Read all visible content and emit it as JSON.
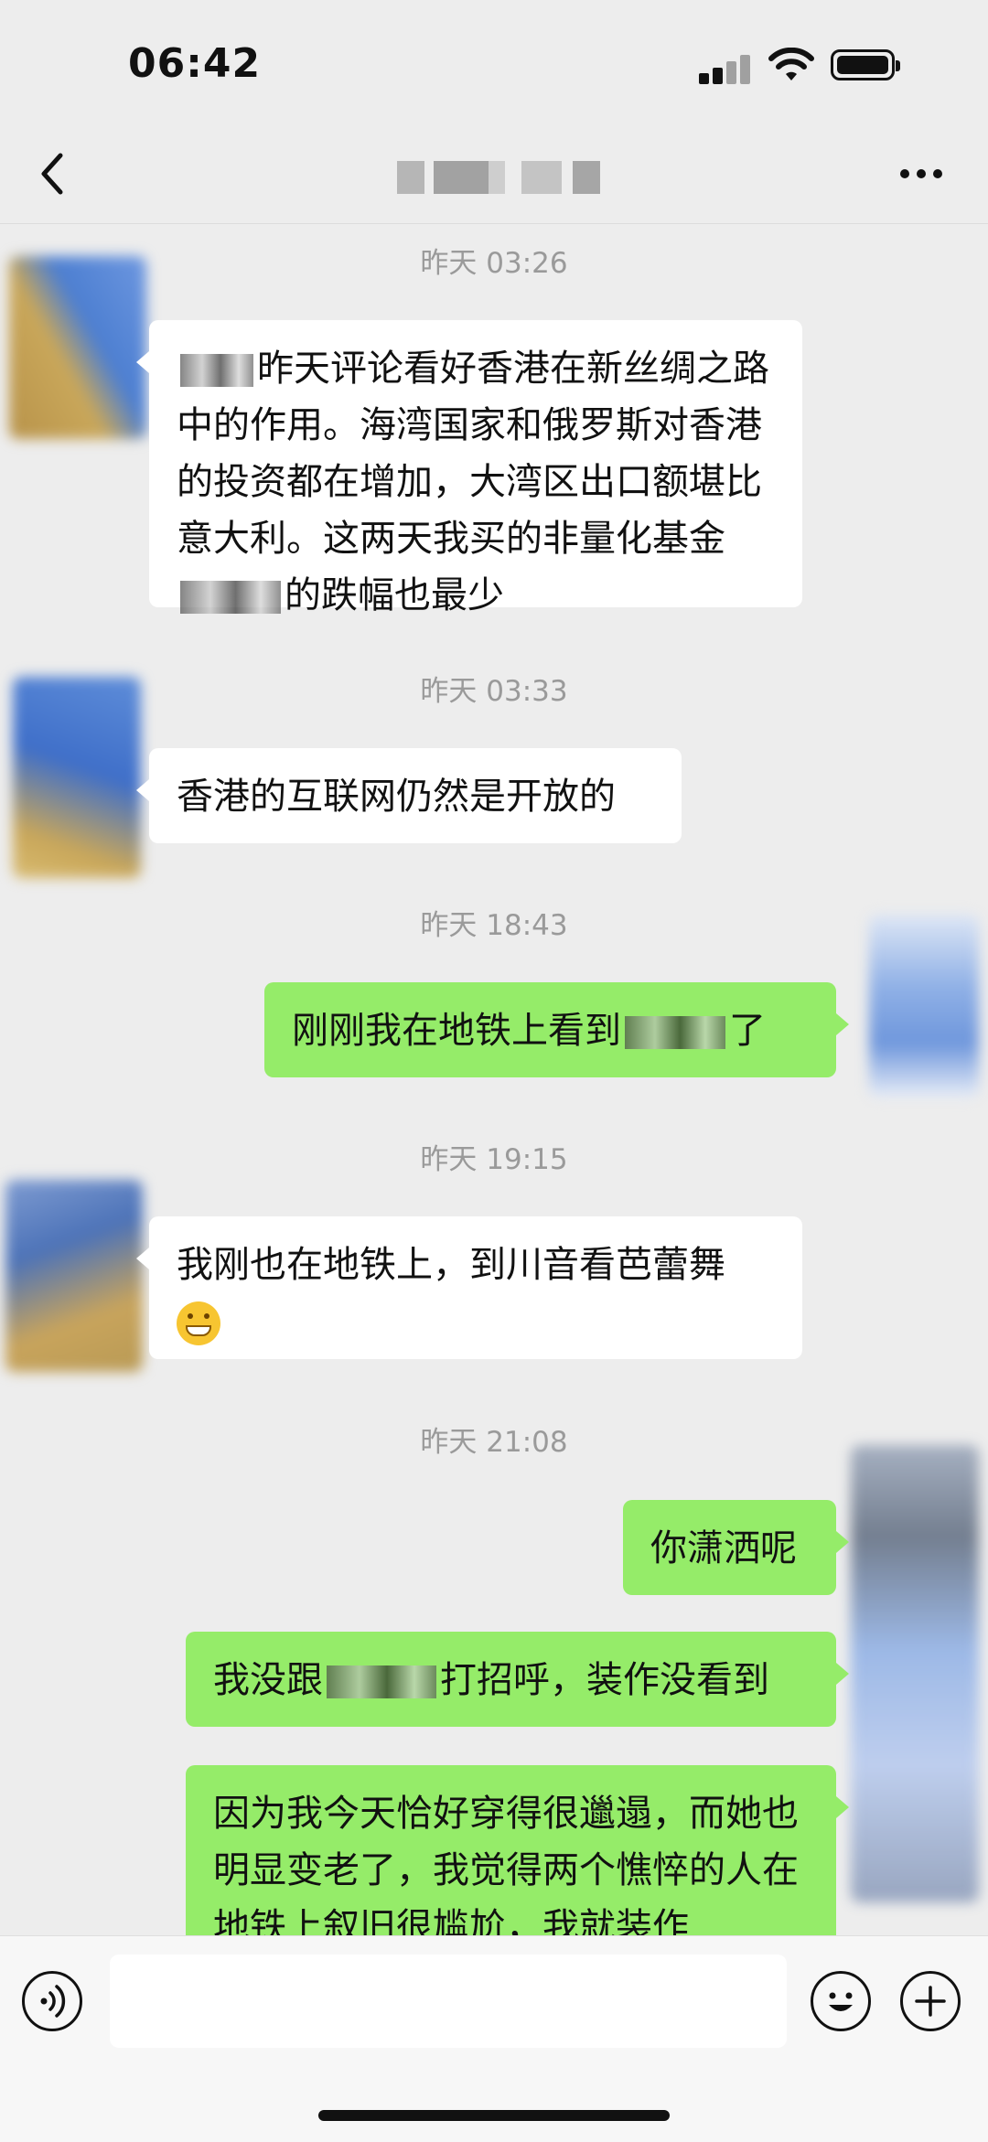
{
  "status_bar": {
    "time": "06:42"
  },
  "header": {
    "title": ""
  },
  "messages": [
    {
      "type": "timestamp",
      "text": "昨天 03:26"
    },
    {
      "type": "incoming",
      "pre": "",
      "blur1": "",
      "text1": "昨天评论看好香港在新丝绸之路中的作用。海湾国家和俄罗斯对香港的投资都在增加，大湾区出口额堪比意大利。这两天我买的非量化基金",
      "blur2": "",
      "text2": "的跌幅也最少"
    },
    {
      "type": "timestamp",
      "text": "昨天 03:33"
    },
    {
      "type": "incoming",
      "text": "香港的互联网仍然是开放的"
    },
    {
      "type": "timestamp",
      "text": "昨天 18:43"
    },
    {
      "type": "outgoing",
      "text1": "刚刚我在地铁上看到",
      "text2": "了"
    },
    {
      "type": "timestamp",
      "text": "昨天 19:15"
    },
    {
      "type": "incoming",
      "text": "我刚也在地铁上，到川音看芭蕾舞"
    },
    {
      "type": "timestamp",
      "text": "昨天 21:08"
    },
    {
      "type": "outgoing",
      "text": "你潇洒呢"
    },
    {
      "type": "outgoing",
      "text1": "我没跟",
      "text2": "打招呼，装作没看到"
    },
    {
      "type": "outgoing",
      "text": "因为我今天恰好穿得很邋遢，而她也明显变老了，我觉得两个憔悴的人在地铁上叙旧很尴尬，我就装作"
    }
  ],
  "input_bar": {
    "placeholder": ""
  },
  "colors": {
    "background": "#ededed",
    "outgoing_bubble": "#95ec69",
    "incoming_bubble": "#ffffff",
    "timestamp": "#9a9a9a"
  },
  "icons": [
    "back-icon",
    "more-icon",
    "voice-icon",
    "emoji-icon",
    "plus-icon"
  ]
}
